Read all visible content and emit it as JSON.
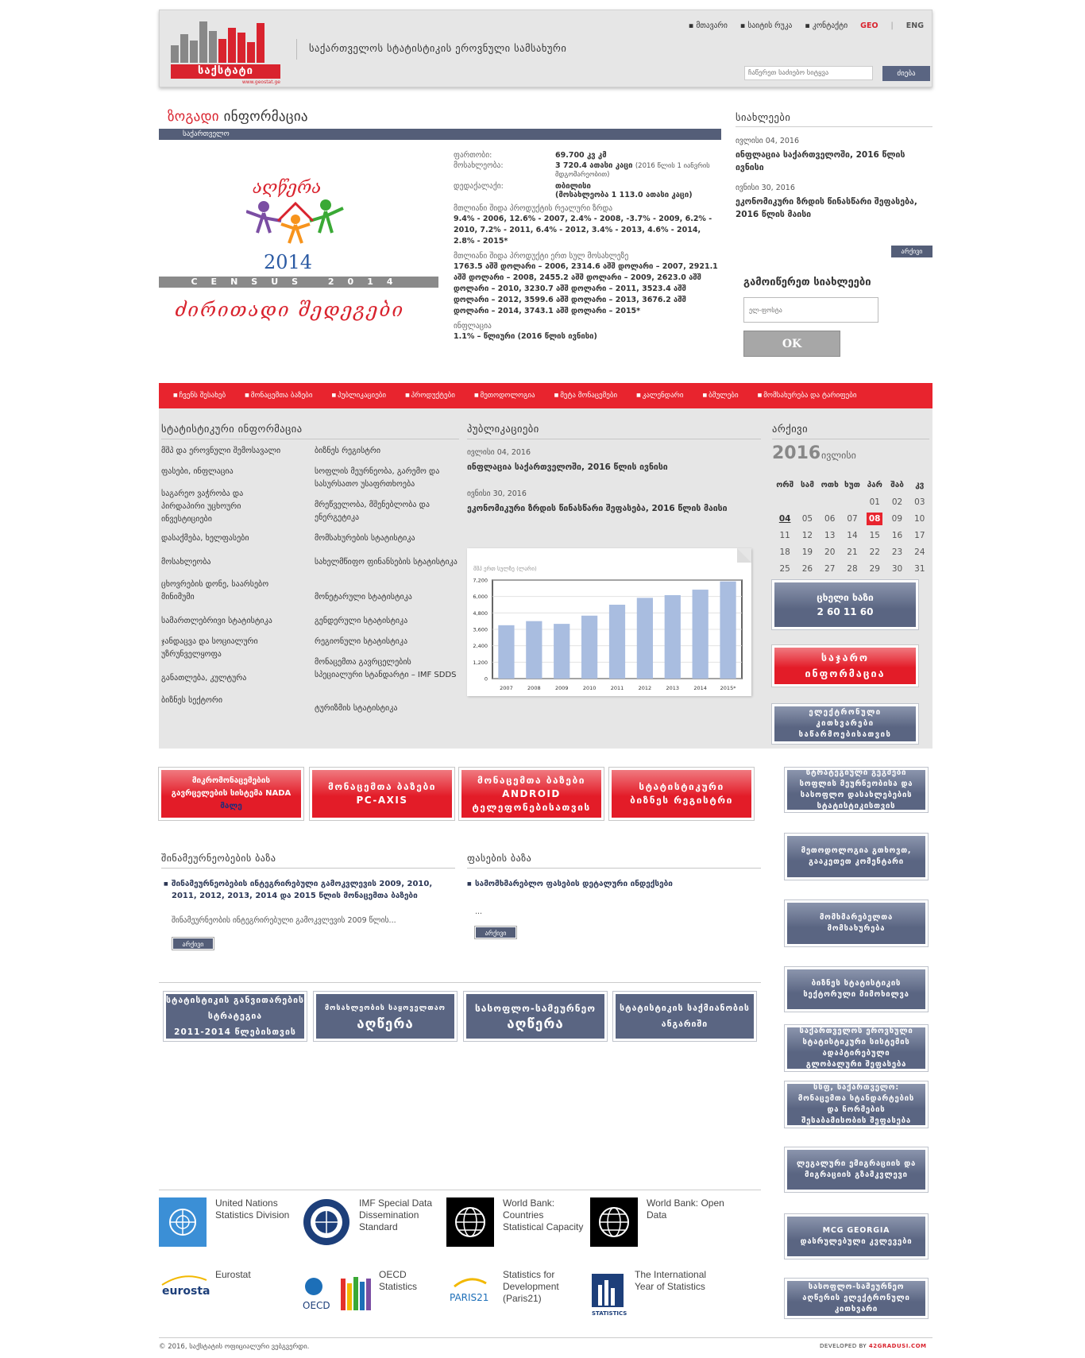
{
  "header": {
    "brand": "საქსტატი",
    "url": "www.geostat.ge",
    "title": "საქართველოს სტატისტიკის ეროვნული სამსახური",
    "nav": [
      "▪ მთავარი",
      "▪ საიტის რუკა",
      "▪ კონტაქტი"
    ],
    "lang_geo": "GEO",
    "lang_sep": "|",
    "lang_eng": "ENG",
    "search_placeholder": "ჩაწერეთ საძიებო სიტყვა",
    "search_button": "ძიება"
  },
  "general": {
    "title_red": "ზოგადი",
    "title_rest": " ინფორმაცია",
    "bar": "საქართველო",
    "census_word": "აღწერა",
    "census_year": "2014",
    "census_band": "CENSUS 2014",
    "census_results": "ძირითადი შედეგები",
    "area_label": "ფართობი:",
    "area_value": "69.700 კვ კმ",
    "pop_label": "მოსახლეობა:",
    "pop_value": "3 720.4 ათასი კაცი",
    "pop_note": "(2016 წლის 1 იანვრის მდგომარეობით)",
    "capital_label": "დედაქალაქი:",
    "capital_value": "თბილისი",
    "capital_note": "(მოსახლეობა 1 113.0 ათასი კაცი)",
    "gdp_growth_label": "მთლიანი შიდა პროდუქტის რეალური ზრდა",
    "gdp_growth_value": "9.4% - 2006, 12.6% - 2007, 2.4% - 2008, -3.7% - 2009, 6.2% - 2010, 7.2% - 2011, 6.4% - 2012, 3.4% - 2013, 4.6% - 2014, 2.8% - 2015*",
    "gdp_pc_label": "მთლიანი შიდა პროდუქტი ერთ სულ მოსახლეზე",
    "gdp_pc_value": "1763.5 აშშ დოლარი – 2006, 2314.6 აშშ დოლარი – 2007, 2921.1 აშშ დოლარი – 2008, 2455.2 აშშ დოლარი – 2009, 2623.0 აშშ დოლარი – 2010, 3230.7 აშშ დოლარი – 2011, 3523.4 აშშ დოლარი – 2012,  3599.6 აშშ დოლარი – 2013,  3676.2 აშშ დოლარი  – 2014,  3743.1 აშშ დოლარი  – 2015*",
    "inflation_label": "ინფლაცია",
    "inflation_value": "1.1% – წლიური (2016 წლის ივნისი)"
  },
  "news": {
    "title": "სიახლეები",
    "items": [
      {
        "date": "ივლისი 04, 2016",
        "title": "ინფლაცია საქართველოში, 2016 წლის ივნისი"
      },
      {
        "date": "ივნისი 30, 2016",
        "title": "ეკონომიკური ზრდის წინასწარი შეფასება, 2016 წლის მაისი"
      }
    ],
    "archive": "არქივი",
    "subscribe_title": "გამოიწერეთ სიახლეები",
    "email_placeholder": "ელ-ფოსტა",
    "ok": "OK"
  },
  "rednav": [
    "ჩვენს შესახებ",
    "მონაცემთა ბაზები",
    "პუბლიკაციები",
    "პროდუქტები",
    "მეთოდოლოგია",
    "მეტა მონაცემები",
    "კალენდარი",
    "ბმულები",
    "მომსახურება და ტარიფები"
  ],
  "stat_info": {
    "title": "სტატისტიკური ინფორმაცია",
    "col1": [
      "მშპ და ეროვნული შემოსავალი",
      "ფასები, ინფლაცია",
      "საგარეო ვაჭრობა და პირდაპირი უცხოური ინვესტიციები",
      "დასაქმება, ხელფასები",
      "მოსახლეობა",
      "ცხოვრების დონე, საარსებო მინიმუმი",
      "სამართლებრივი სტატისტიკა",
      "ჯანდაცვა და სოციალური უზრუნველყოფა",
      "განათლება, კულტურა",
      "ბიზნეს სექტორი"
    ],
    "col2": [
      "ბიზნეს რეგისტრი",
      "სოფლის მეურნეობა, გარემო და სასურსათო უსაფრთხოება",
      "მრეწველობა, მშენებლობა და ენერგეტიკა",
      "მომსახურების სტატისტიკა",
      "სახელმწიფო ფინანსების სტატისტიკა",
      "მონეტარული სტატისტიკა",
      "გენდერული სტატისტიკა",
      "რეგიონული სტატისტიკა",
      "მონაცემთა გავრცელების სპეციალური სტანდარტი – IMF SDDS",
      "ტურიზმის სტატისტიკა"
    ]
  },
  "publications": {
    "title": "პუბლიკაციები",
    "items": [
      {
        "date": "ივლისი 04, 2016",
        "title": "ინფლაცია საქართველოში, 2016 წლის ივნისი"
      },
      {
        "date": "ივნისი 30, 2016",
        "title": "ეკონომიკური ზრდის წინასწარი შეფასება, 2016 წლის მაისი"
      }
    ]
  },
  "chart_data": {
    "type": "bar",
    "title": "მშპ ერთ სულზე (ლარი)",
    "categories": [
      "2007",
      "2008",
      "2009",
      "2010",
      "2011",
      "2012",
      "2013",
      "2014",
      "2015*"
    ],
    "values": [
      3900,
      4200,
      4000,
      4600,
      5400,
      5900,
      6100,
      6500,
      7100
    ],
    "ylim": [
      0,
      7200
    ],
    "yticks": [
      "0",
      "1,200",
      "2,400",
      "3,600",
      "4,800",
      "6,000",
      "7,200"
    ],
    "tick_values": [
      0,
      1200,
      2400,
      3600,
      4800,
      6000,
      7200
    ],
    "grid": true,
    "color": "#a9bde0"
  },
  "archive": {
    "title": "არქივი",
    "year": "2016",
    "month": "ივლისი",
    "weekdays": [
      "ორშ",
      "სამ",
      "ოთხ",
      "ხუთ",
      "პარ",
      "შაბ",
      "კვ"
    ],
    "weeks": [
      [
        "",
        "",
        "",
        "",
        "01",
        "02",
        "03"
      ],
      [
        "04",
        "05",
        "06",
        "07",
        "08",
        "09",
        "10"
      ],
      [
        "11",
        "12",
        "13",
        "14",
        "15",
        "16",
        "17"
      ],
      [
        "18",
        "19",
        "20",
        "21",
        "22",
        "23",
        "24"
      ],
      [
        "25",
        "26",
        "27",
        "28",
        "29",
        "30",
        "31"
      ]
    ],
    "current_day": "04",
    "highlight_day": "08"
  },
  "side_boxes": {
    "hotline_label": "ცხელი ხაზი",
    "hotline_number": "2 60 11 60",
    "public_info": "საჯარო ინფორმაცია",
    "e_questionnaires": "ელექტრონული კითხვარები საწარმოებისათვის"
  },
  "red_buttons": [
    {
      "lines": [
        "მიკრომონაცემების",
        "გავრცელების სისტემა NADA"
      ],
      "extra": "მალე"
    },
    {
      "lines": [
        "მონაცემთა ბაზები",
        "PC-AXIS"
      ],
      "extra": ""
    },
    {
      "lines": [
        "მონაცემთა ბაზები",
        "ANDROID",
        "ტელეფონებისათვის"
      ],
      "extra": ""
    },
    {
      "lines": [
        "სტატისტიკური",
        "ბიზნეს რეგისტრი"
      ],
      "extra": ""
    }
  ],
  "households_db": {
    "title": "შინამეურნეობების ბაზა",
    "item": "შინამეურნეობების ინტეგრირებული გამოკვლევის 2009, 2010, 2011, 2012, 2013, 2014 და 2015 წლის მონაცემთა ბაზები",
    "sub": "შინამეურნეობის ინტეგრირებული გამოკვლევის 2009 წლის...",
    "archive": "არქივი"
  },
  "prices_db": {
    "title": "ფასების ბაზა",
    "item": "სამომხმარებლო ფასების დეტალური ინდექსები",
    "sub": "...",
    "archive": "არქივი"
  },
  "bottom_buttons": [
    {
      "lines": [
        "სტატისტიკის განვითარების",
        "სტრატეგია",
        "2011-2014 წლებისთვის"
      ]
    },
    {
      "lines": [
        "მოსახლეობის საყოველთაო",
        "აღწერა"
      ]
    },
    {
      "lines": [
        "სასოფლო-სამეურნეო",
        "აღწერა"
      ]
    },
    {
      "lines": [
        "სტატისტიკის საქმიანობის",
        "ანგარიში"
      ]
    }
  ],
  "right_boxes": [
    "სტრატეგიული გეგმები სოფლის მეურნეობისა და სასოფლო დასახლებების სტატისტიკისთვის",
    "მეთოდოლოგია გთხოვთ, გააკეთეთ კომენტარი",
    "მომხმარებელთა მომსახურება",
    "ბიზნეს სტატისტიკის სექტორული მიმოხილვა",
    "საქართველოს ეროვნული სტატისტიკური სისტემის ადაპტირებული გლობალური შეფასება",
    "სსფ, საქართველო: მონაცემთა სტანდარტების და ნორმების შესაბამისობის შეფასება",
    "ლეგალური ემიგრაციის და მიგრაციის გზამკვლევი",
    "MCG GEORGIA დასრულებული კვლევები",
    "სასოფლო-სამეურნეო აღწერის ელექტრონული კითხვარი"
  ],
  "partners": [
    {
      "name": "United Nations Statistics Division"
    },
    {
      "name": "IMF Special Data Dissemination Standard"
    },
    {
      "name": "World Bank: Countries Statistical Capacity"
    },
    {
      "name": "World Bank: Open Data"
    },
    {
      "name": "Eurostat"
    },
    {
      "name": "OECD Statistics"
    },
    {
      "name": "Statistics for Development (Paris21)"
    },
    {
      "name": "The International Year of Statistics"
    }
  ],
  "partner_logo_text": {
    "eurostat": "eurostat",
    "oecd": "OECD",
    "paris21": "PARIS21",
    "intl": "STATISTICS"
  },
  "footer": {
    "copyright": "© 2016, საქსტატის ოფიციალური ვებგვერდი.",
    "developed_by": "DEVELOPED BY",
    "developer": "42GRADUSI.COM"
  }
}
